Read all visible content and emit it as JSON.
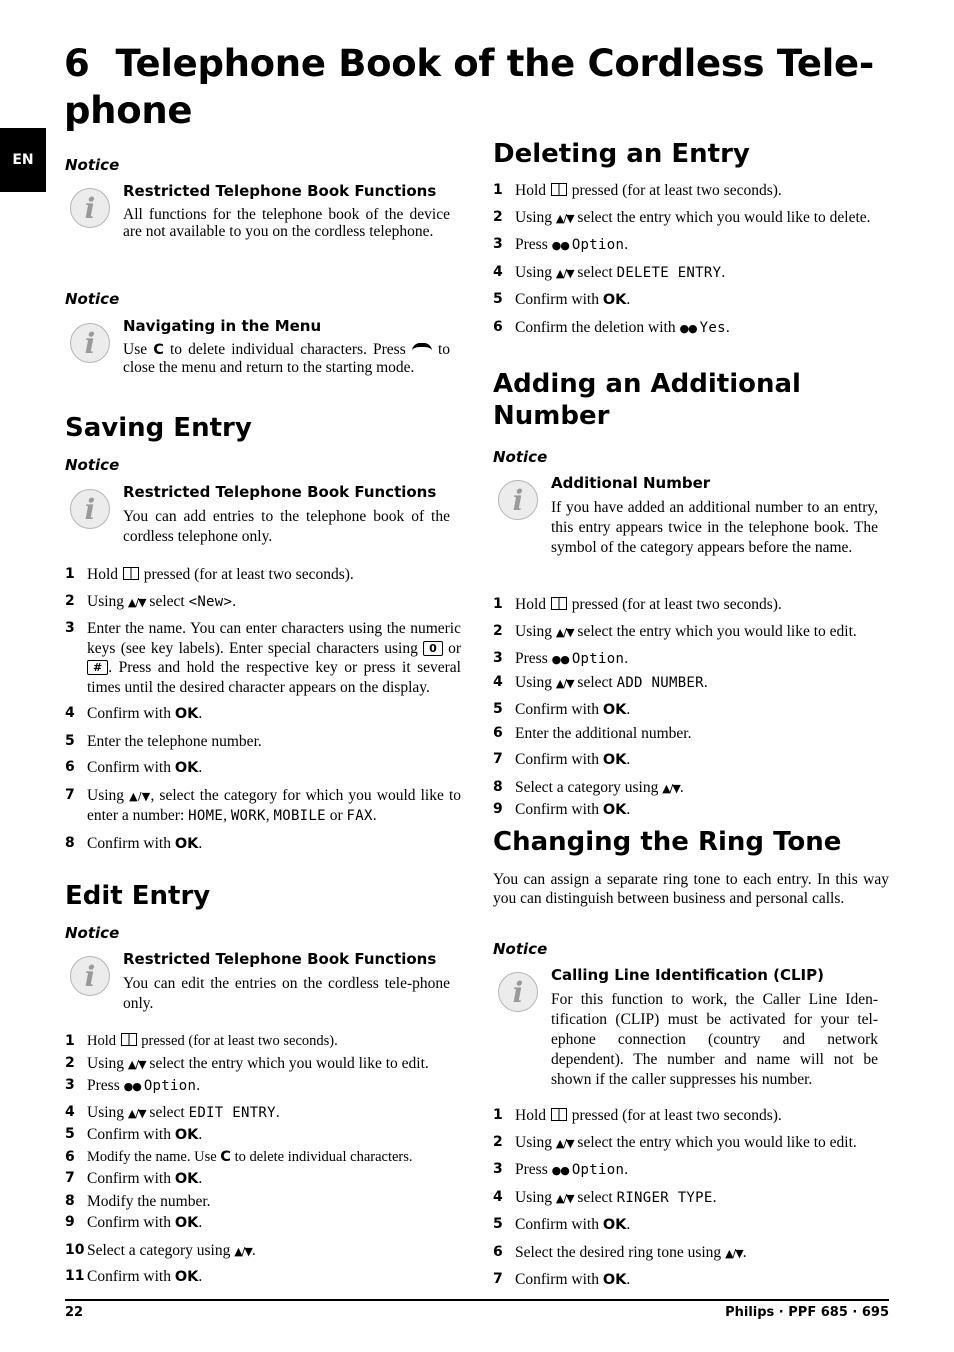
{
  "chapter": {
    "number": "6",
    "title_line1": "Telephone Book of the Cordless Tele-",
    "title_line2": "phone"
  },
  "lang_tab": "EN",
  "common": {
    "notice_label": "Notice",
    "hold_pre": "Hold",
    "hold_post": "pressed (for at least two seconds).",
    "using": "Using",
    "press": "Press",
    "option_display": "Option",
    "confirm_with": "Confirm with",
    "ok_key": "OK",
    "icons": {
      "phonebook": "book-icon",
      "navigation": "up-down-arrow-icon",
      "softkey": "double-dot-softkey-icon",
      "info": "info-icon",
      "hangup": "hangup-icon"
    }
  },
  "left": {
    "notice1": {
      "title": "Restricted Telephone Book Functions",
      "text": "All functions for the telephone book of the device are not available to you on the cordless telephone."
    },
    "notice2": {
      "title": "Navigating in the Menu",
      "text_use": "Use",
      "key_c": "C",
      "text_mid": "to delete individual characters. Press",
      "text_end": "to close the menu and return to the starting mode."
    },
    "saving": {
      "heading": "Saving Entry",
      "notice_title": "Restricted Telephone Book Functions",
      "notice_text": "You can add entries to the telephone book of the cordless telephone only.",
      "steps": {
        "s2_select": "select",
        "s2_value": "<New>",
        "s3_a": "Enter the name. You can enter characters using the numeric keys (see key labels). Enter special characters using",
        "s3_key0": "0",
        "s3_or": "or",
        "s3_keyhash": "#",
        "s3_b": ". Press and hold the respective key or press it several times until the desired character appears on the display.",
        "s5": "Enter the telephone number.",
        "s7_a": ", select the category for which you would like to enter a number:",
        "s7_home": "HOME",
        "s7_work": "WORK",
        "s7_mobile": "MOBILE",
        "s7_or": "or",
        "s7_fax": "FAX"
      }
    },
    "edit": {
      "heading": "Edit Entry",
      "notice_title": "Restricted Telephone Book Functions",
      "notice_text": "You can edit the entries on the cordless tele-phone only.",
      "steps": {
        "s2": "select the entry which you would like to edit.",
        "s4_select": "select",
        "s4_value": "EDIT ENTRY",
        "s6_a": "Modify the name. Use",
        "s6_key": "C",
        "s6_b": "to delete individual characters.",
        "s8": "Modify the number.",
        "s10": "Select a category using"
      }
    }
  },
  "right": {
    "deleting": {
      "heading": "Deleting an Entry",
      "steps": {
        "s2": "select the entry which you would like to delete.",
        "s4_select": "select",
        "s4_value": "DELETE ENTRY",
        "s6_a": "Confirm the deletion with",
        "s6_value": "Yes"
      }
    },
    "adding": {
      "heading_line1": "Adding an Additional",
      "heading_line2": "Number",
      "notice_title": "Additional Number",
      "notice_text": "If you have added an additional number to an entry, this entry appears twice in the telephone book. The symbol of the category appears before the name.",
      "steps": {
        "s2": "select the entry which you would like to edit.",
        "s4_select": "select",
        "s4_value": "ADD NUMBER",
        "s6": "Enter the additional number.",
        "s8": "Select a category using"
      }
    },
    "ring": {
      "heading": "Changing the Ring Tone",
      "intro": "You can assign a separate ring tone to each entry. In this way you can distinguish between business and personal calls.",
      "notice_title": "Calling Line Identification (CLIP)",
      "notice_text": "For this function to work, the Caller Line Iden-tification (CLIP) must be activated for your tel-ephone connection (country and network dependent). The number and name will not be shown if the caller suppresses his number.",
      "steps": {
        "s2": "select the entry which you would like to edit.",
        "s4_select": "select",
        "s4_value": "RINGER TYPE",
        "s6": "Select the desired ring tone using"
      }
    }
  },
  "footer": {
    "page_number": "22",
    "brand": "Philips · PPF 685 · 695"
  }
}
